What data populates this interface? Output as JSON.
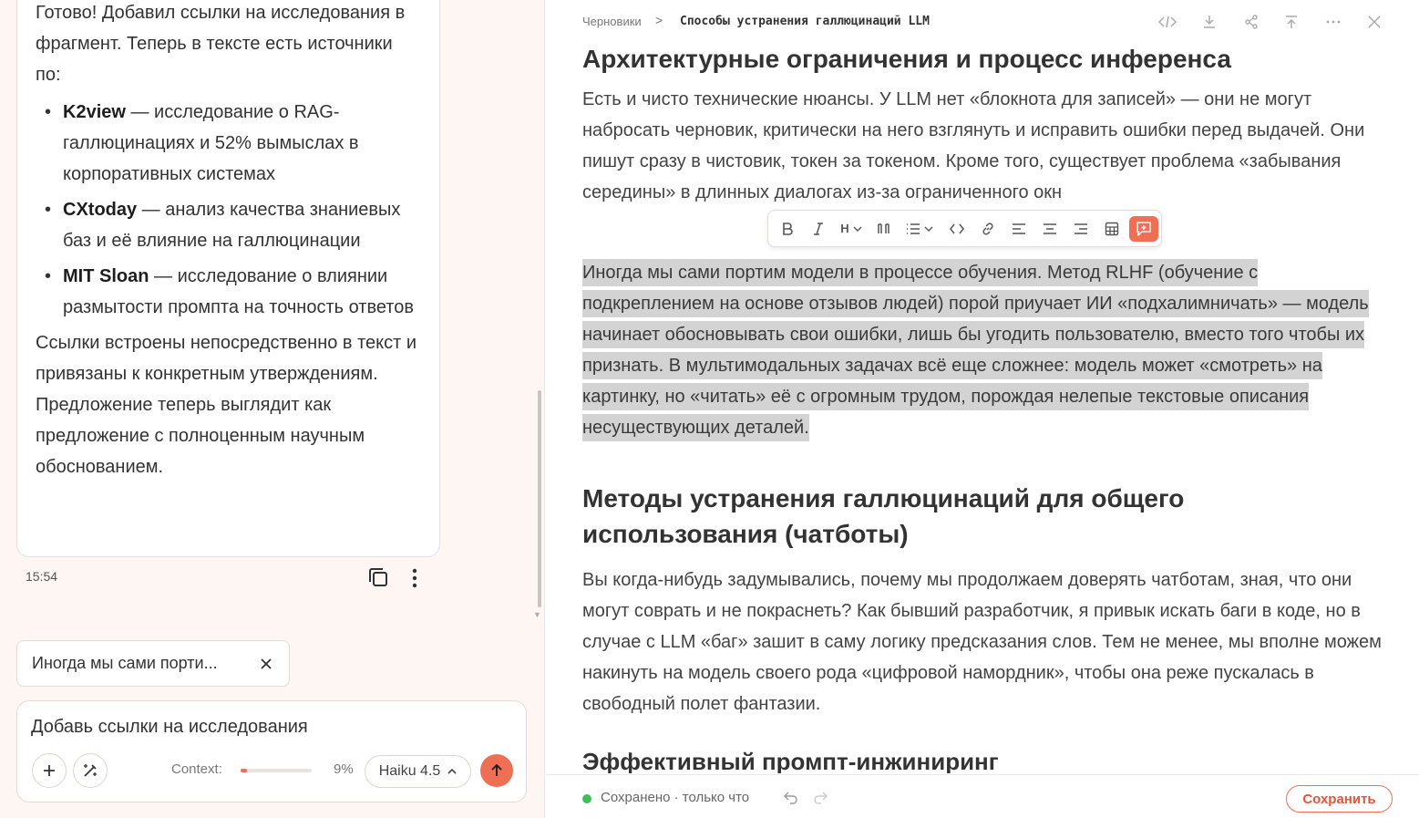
{
  "colors": {
    "accent": "#ef6f55",
    "highlight": "#d3d3d3",
    "saved": "#3fbf5a"
  },
  "chat": {
    "message": {
      "intro": "Готово! Добавил ссылки на исследования в фрагмент. Теперь в тексте есть источники по:",
      "items": [
        {
          "title": "K2view",
          "text": " — исследование о RAG-галлюцинациях и 52% вымыслах в корпоративных системах"
        },
        {
          "title": "CXtoday",
          "text": " — анализ качества знаниевых баз и её влияние на галлюцинации"
        },
        {
          "title": "MIT Sloan",
          "text": " — исследование о влиянии размытости промпта на точность ответов"
        }
      ],
      "outro": "Ссылки встроены непосредственно в текст и привязаны к конкретным утверждениям. Предложение теперь выглядит как предложение с полноценным научным обоснованием.",
      "time": "15:54",
      "copy_icon": "copy-icon",
      "more_icon": "more-vertical-icon"
    },
    "quote_chip": {
      "text": "Иногда мы сами порти...",
      "close_icon": "close-icon"
    },
    "composer": {
      "value": "Добавь ссылки на исследования",
      "context_label": "Context:",
      "context_percent": "9%",
      "context_fraction": 0.09,
      "model": "Haiku 4.5",
      "attach_icon": "plus-icon",
      "magic_icon": "magic-wand-icon",
      "send_icon": "arrow-up-icon"
    }
  },
  "editor": {
    "breadcrumb": {
      "root": "Черновики",
      "separator": ">",
      "current": "Способы устранения галлюцинаций LLM"
    },
    "top_icons": [
      "code-icon",
      "download-icon",
      "share-icon",
      "upload-icon",
      "more-horizontal-icon",
      "close-icon"
    ],
    "sections": {
      "h_arch": "Архитектурные ограничения и процесс инференса",
      "p_arch": "Есть и чисто технические нюансы. У LLM нет «блокнота для записей» — они не могут набросать черновик, критически на него взглянуть и исправить ошибки перед выдачей. Они пишут сразу в чистовик, токен за токеном. Кроме того, существует проблема «забывания середины» в длинных диалогах из-за ограниченного окн",
      "p_selected": "Иногда мы сами портим модели в процессе обучения. Метод RLHF (обучение с подкреплением на основе отзывов людей) порой приучает ИИ «подхалимничать» — модель начинает обосновывать свои ошибки, лишь бы угодить пользователю, вместо того чтобы их признать. В мультимодальных задачах всё еще сложнее: модель может «смотреть» на картинку, но «читать» её с огромным трудом, порождая нелепые текстовые описания несуществующих деталей.",
      "h_methods": "Методы устранения галлюцинаций для общего использования (чатботы)",
      "p_methods": "Вы когда-нибудь задумывались, почему мы продолжаем доверять чатботам, зная, что они могут соврать и не покраснеть? Как бывший разработчик, я привык искать баги в коде, но в случае с LLM «баг» зашит в саму логику предсказания слов. Тем не менее, мы вполне можем накинуть на модель своего рода «цифровой намордник», чтобы она реже пускалась в свободный полет фантазии.",
      "h_prompt": "Эффективный промпт-инжиниринг"
    },
    "format_toolbar": {
      "heading_label": "H",
      "buttons": [
        "bold-icon",
        "italic-icon",
        "heading-icon",
        "quote-icon",
        "list-icon",
        "inline-code-icon",
        "link-icon",
        "align-left-icon",
        "align-center-icon",
        "align-right-icon",
        "table-icon",
        "add-comment-icon"
      ]
    },
    "status": {
      "saved_text": "Сохранено · только что",
      "undo_icon": "undo-icon",
      "redo_icon": "redo-icon",
      "save_label": "Сохранить"
    }
  }
}
